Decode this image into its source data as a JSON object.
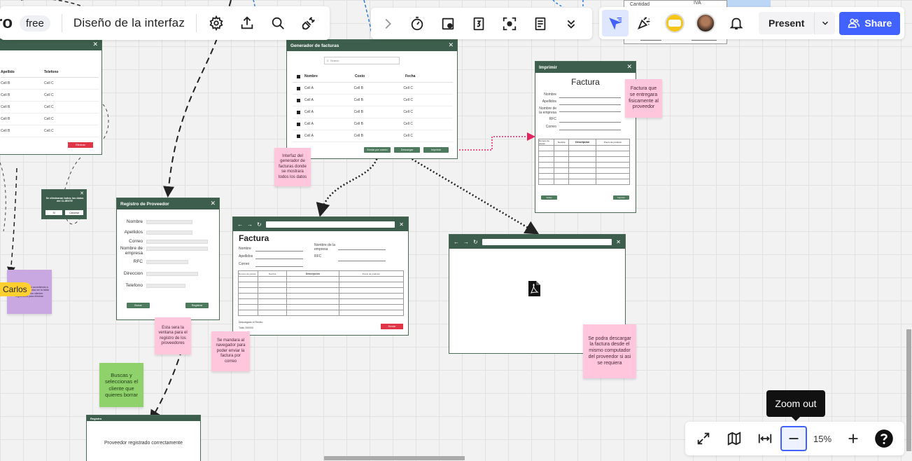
{
  "app": {
    "logo_text": "ro",
    "plan_badge": "free",
    "board_title": "Diseño de la interfaz"
  },
  "top_toolbar": {
    "present_label": "Present",
    "share_label": "Share"
  },
  "zoom": {
    "level": "15%",
    "tooltip": "Zoom out"
  },
  "top_partial": {
    "cantidad_label": "Cantidad",
    "iva_label": "IVA"
  },
  "left_table": {
    "headers": [
      "Apellido",
      "Telefono"
    ],
    "rows": [
      [
        "Cell B",
        "Cell C"
      ],
      [
        "Cell B",
        "Cell C"
      ],
      [
        "Cell B",
        "Cell C"
      ],
      [
        "Cell B",
        "Cell C"
      ],
      [
        "Cell B",
        "Cell C"
      ]
    ],
    "button": "Eliminar"
  },
  "delete_dialog": {
    "text": "Se eliminaran todos los datos del CLIENTE",
    "btn_yes": "Si",
    "btn_cancel": "Cancelar"
  },
  "generador": {
    "title": "Generador de facturas",
    "search_placeholder": "Search",
    "headers": [
      "Nombre",
      "Costo",
      "Fecha"
    ],
    "rows": [
      [
        "Cell A",
        "Cell B",
        "Cell C"
      ],
      [
        "Cell A",
        "Cell B",
        "Cell C"
      ],
      [
        "Cell A",
        "Cell B",
        "Cell C"
      ],
      [
        "Cell A",
        "Cell B",
        "Cell C"
      ],
      [
        "Cell A",
        "Cell B",
        "Cell C"
      ]
    ],
    "buttons": [
      "Enviar por correo",
      "Descargar",
      "Imprimir"
    ]
  },
  "registro": {
    "title": "Registro de Proveedor",
    "fields": [
      "Nombre",
      "Apellidos",
      "Correo",
      "Nombre de empresa",
      "RFC",
      "Direccion",
      "Telefono"
    ],
    "btn_left": "Borrar",
    "btn_right": "Registrar"
  },
  "factura_browser": {
    "title": "Factura",
    "left_fields": [
      "Nombre",
      "Apellidos",
      "Correo"
    ],
    "right_fields": [
      "Nombre de la empresa",
      "RFC"
    ],
    "table_headers": [
      "Numero de piezas",
      "Nombre",
      "Descripcion",
      "Precio de producto"
    ],
    "footer_line1": "Descargado el Recibo",
    "footer_line2": "Total: 000000",
    "send_btn": "Enviar"
  },
  "imprimir": {
    "title": "Imprimir",
    "heading": "Factura",
    "fields": [
      "Nombre",
      "Apellidos",
      "Nombre de la empresa",
      "RFC",
      "Correo"
    ],
    "table_headers": [
      "Numero de piezas",
      "Nombre",
      "Descripcion",
      "Precio de producto"
    ],
    "btn_left": "Volver",
    "btn_right": "Imprimir"
  },
  "registered": {
    "title": "Registro",
    "message": "Proveedor registrado correctamente"
  },
  "stickies": {
    "generador_note": "Interfaz del generador de facturas donde se mostrara todos los datos",
    "imprimir_note": "Factura que se entregara fisicamente al proveedor",
    "registro_note": "Esta sera la ventana para el registro de los proveedores",
    "correo_note": "Se mandara al navegador para poder enviar la factura por correo",
    "descarga_note": "Se podra descargar la factura desde el mismo computador del proveedor si asi se requiera",
    "buscar_note": "Buscas y seleccionas el cliente que quieres borrar",
    "purple_note": "El usuario que este accediendo a la base de datos podra ver la tabla completa de los clientes registrados para eliminar",
    "user_tag": "Carlos"
  },
  "colors": {
    "frame_header": "#3d5e4c",
    "accent": "#4262ff",
    "sticky_pink": "#ffc6dc",
    "sticky_green": "#8fd26b",
    "sticky_purple": "#c9a7e0",
    "user_tag": "#ffd02f"
  }
}
